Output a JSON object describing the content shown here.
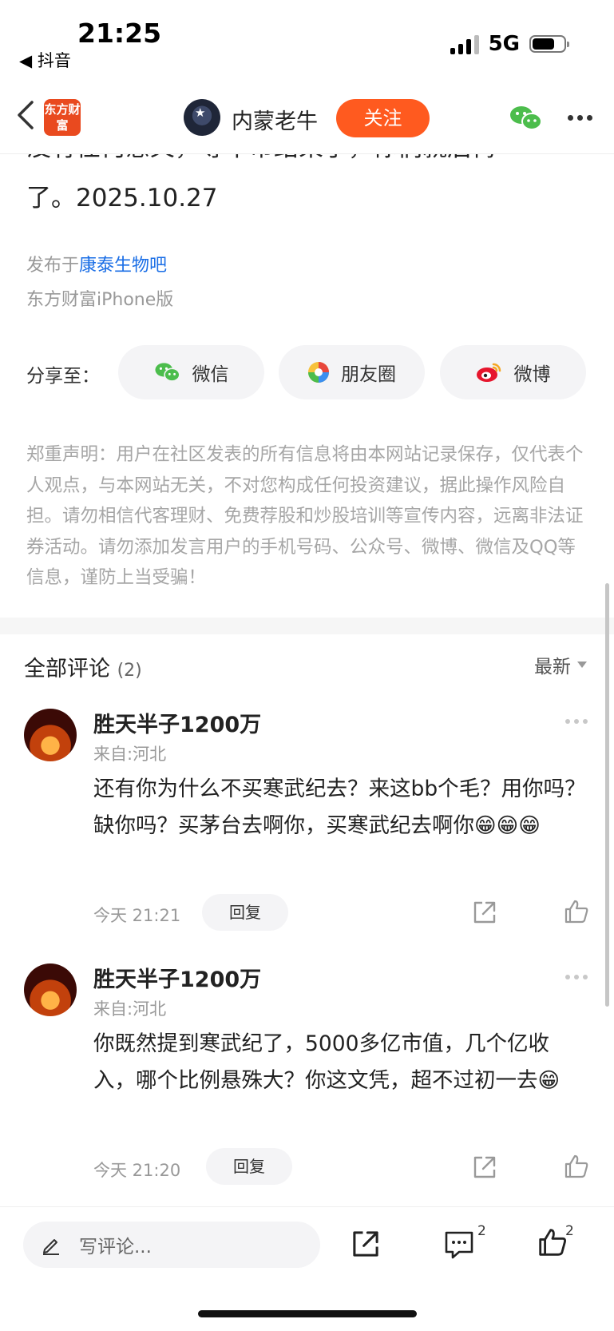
{
  "status_bar": {
    "time": "21:25",
    "back_app": "◀ 抖音",
    "network": "5G"
  },
  "header": {
    "logo_text": "东方财富",
    "author_name": "内蒙老牛",
    "follow_label": "关注"
  },
  "article": {
    "cut_line": "没有任何意义，等牛市结束了，你们就后悔",
    "text_tail": "了。2025.10.27",
    "published_prefix": "发布于",
    "published_forum": "康泰生物吧",
    "client": "东方财富iPhone版"
  },
  "share": {
    "label": "分享至：",
    "wechat": "微信",
    "moments": "朋友圈",
    "weibo": "微博"
  },
  "disclaimer": "郑重声明：用户在社区发表的所有信息将由本网站记录保存，仅代表个人观点，与本网站无关，不对您构成任何投资建议，据此操作风险自担。请勿相信代客理财、免费荐股和炒股培训等宣传内容，远离非法证券活动。请勿添加发言用户的手机号码、公众号、微博、微信及QQ等信息，谨防上当受骗！",
  "comments": {
    "title": "全部评论",
    "count": "(2)",
    "sort": "最新",
    "items": [
      {
        "name": "胜天半子1200万",
        "from": "来自:河北",
        "body": "还有你为什么不买寒武纪去？来这bb个毛？用你吗？缺你吗？买茅台去啊你，买寒武纪去啊你😁😁😁",
        "time": "今天 21:21",
        "reply": "回复"
      },
      {
        "name": "胜天半子1200万",
        "from": "来自:河北",
        "body": "你既然提到寒武纪了，5000多亿市值，几个亿收入，哪个比例悬殊大？你这文凭，超不过初一去😁",
        "time": "今天 21:20",
        "reply": "回复"
      }
    ]
  },
  "bottom_bar": {
    "placeholder": "写评论...",
    "comment_count": "2",
    "like_count": "2"
  }
}
